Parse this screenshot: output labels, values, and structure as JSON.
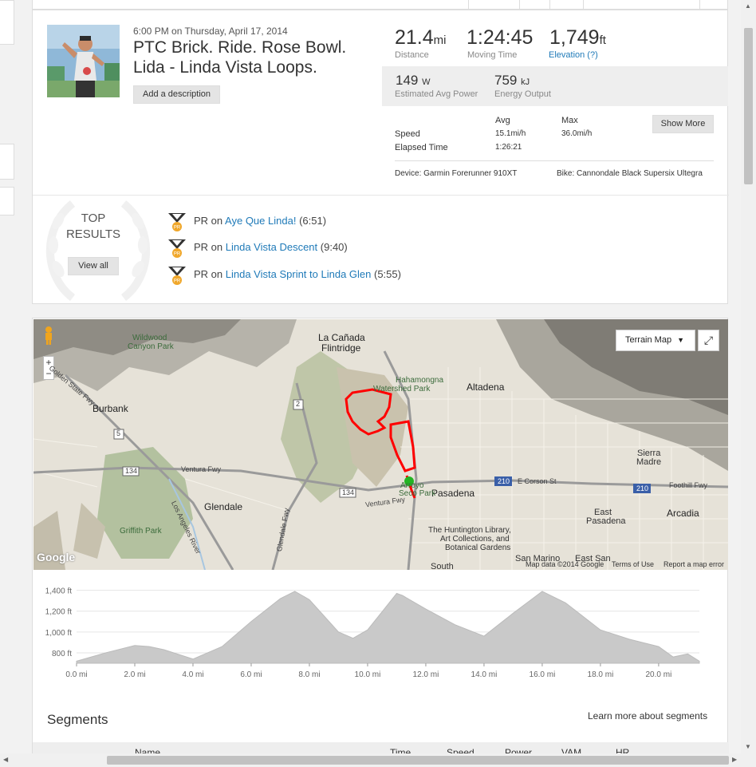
{
  "activity": {
    "date": "6:00 PM on Thursday, April 17, 2014",
    "title_line1": "PTC Brick. Ride. Rose Bowl.",
    "title_line2": "Lida - Linda Vista Loops.",
    "add_description": "Add a description"
  },
  "stats": {
    "distance": {
      "value": "21.4",
      "unit": "mi",
      "label": "Distance"
    },
    "moving_time": {
      "value": "1:24:45",
      "label": "Moving Time"
    },
    "elevation": {
      "value": "1,749",
      "unit": "ft",
      "label": "Elevation (?)"
    },
    "power": {
      "value": "149",
      "unit": "W",
      "label": "Estimated Avg Power"
    },
    "energy": {
      "value": "759",
      "unit": "kJ",
      "label": "Energy Output"
    },
    "table": {
      "col_avg": "Avg",
      "col_max": "Max",
      "speed_label": "Speed",
      "speed_avg": "15.1mi/h",
      "speed_max": "36.0mi/h",
      "elapsed_label": "Elapsed Time",
      "elapsed_avg": "1:26:21"
    },
    "show_more": "Show More",
    "device": "Device: Garmin Forerunner 910XT",
    "bike": "Bike: Cannondale Black Supersix Ultegra"
  },
  "top_results": {
    "title_line1": "TOP",
    "title_line2": "RESULTS",
    "view_all": "View all",
    "items": [
      {
        "prefix": "PR on",
        "segment": "Aye Que Linda!",
        "time": "(6:51)"
      },
      {
        "prefix": "PR on",
        "segment": "Linda Vista Descent",
        "time": "(9:40)"
      },
      {
        "prefix": "PR on",
        "segment": "Linda Vista Sprint to Linda Glen",
        "time": "(5:55)"
      }
    ],
    "medal_text": "PR"
  },
  "map": {
    "terrain_button": "Terrain Map",
    "fullscreen_icon": "fullscreen-icon",
    "labels": {
      "la_canada": "La Cañada",
      "flintridge": "Flintridge",
      "altadena": "Altadena",
      "burbank": "Burbank",
      "glendale": "Glendale",
      "pasadena": "Pasadena",
      "sierra": "Sierra",
      "madre": "Madre",
      "arcadia": "Arcadia",
      "east": "East",
      "east_pasadena": "Pasadena",
      "san_marino": "San Marino",
      "east_san": "East San",
      "south": "South",
      "wildwood1": "Wildwood",
      "wildwood2": "Canyon Park",
      "hahamongna1": "Hahamongna",
      "hahamongna2": "Watershed Park",
      "arroyo1": "Arroyo",
      "arroyo2": "Seco Park",
      "griffith": "Griffith Park",
      "huntington1": "The Huntington Library,",
      "huntington2": "Art Collections, and",
      "huntington3": "Botanical Gardens",
      "golden_state": "Golden State Fwy",
      "ventura_fwy1": "Ventura Fwy",
      "ventura_fwy2": "Ventura Fwy",
      "glendale_fwy": "Glendale Fwy",
      "la_river": "Los Angeles River",
      "e_corson": "E Corson St",
      "foothill": "Foothill Fwy",
      "r2": "2",
      "r5": "5",
      "r134a": "134",
      "r134b": "134",
      "r210a": "210",
      "r210b": "210"
    },
    "footer_data": "Map data ©2014 Google",
    "footer_terms": "Terms of Use",
    "footer_report": "Report a map error",
    "google": "Google"
  },
  "elevation_chart": {
    "y_ticks": [
      "1,400 ft",
      "1,200 ft",
      "1,000 ft",
      "800 ft"
    ],
    "x_ticks": [
      "0.0 mi",
      "2.0 mi",
      "4.0 mi",
      "6.0 mi",
      "8.0 mi",
      "10.0 mi",
      "12.0 mi",
      "14.0 mi",
      "16.0 mi",
      "18.0 mi",
      "20.0 mi"
    ]
  },
  "chart_data": {
    "type": "area",
    "xlabel": "",
    "ylabel": "",
    "xlim": [
      0,
      21.4
    ],
    "ylim": [
      700,
      1420
    ],
    "x": [
      0,
      1,
      2,
      2.5,
      3,
      4,
      5,
      6,
      7,
      7.5,
      8,
      9,
      9.5,
      10,
      11,
      11.2,
      12,
      13,
      14,
      15,
      16,
      16.8,
      18,
      19,
      20,
      20.5,
      21,
      21.4
    ],
    "y": [
      720,
      800,
      870,
      860,
      830,
      740,
      860,
      1100,
      1320,
      1390,
      1310,
      1000,
      940,
      1020,
      1370,
      1350,
      1220,
      1070,
      960,
      1180,
      1390,
      1280,
      1020,
      930,
      860,
      760,
      790,
      720
    ]
  },
  "segments": {
    "title": "Segments",
    "learn_more": "Learn more about segments",
    "columns": [
      "Name",
      "Time",
      "Speed",
      "Power",
      "VAM",
      "HR"
    ]
  }
}
